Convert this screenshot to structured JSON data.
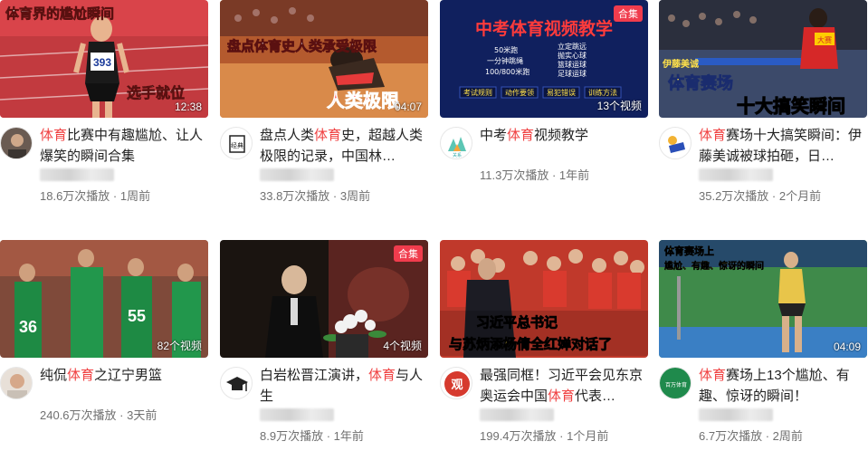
{
  "videos": [
    {
      "title_pre": "",
      "title_kw": "体育",
      "title_post": "比赛中有趣尴尬、让人爆笑的瞬间合集",
      "views": "18.6万次播放",
      "age": "1周前",
      "overlay_top": "体育界的尴尬瞬间",
      "overlay_bottom": "选手就位",
      "bib": "393",
      "duration": "12:38",
      "tag": ""
    },
    {
      "title_pre": "盘点人类",
      "title_kw": "体育",
      "title_post": "史，超越人类极限的记录，中国林…",
      "views": "33.8万次播放",
      "age": "3周前",
      "overlay_top": "盘点体育史人类承受极限",
      "overlay_bottom": "人类极限",
      "duration": "04:07",
      "tag": ""
    },
    {
      "title_pre": "中考",
      "title_kw": "体育",
      "title_post": "视频教学",
      "views": "11.3万次播放",
      "age": "1年前",
      "overlay_top": "中考体育视频教学",
      "lines_left": [
        "50米跑",
        "一分钟跳绳",
        "100/800米跑"
      ],
      "lines_right": [
        "立定跳远",
        "抛实心球",
        "篮球运球",
        "足球运球"
      ],
      "badges": [
        "考试规则",
        "动作要领",
        "易犯错误",
        "训练方法"
      ],
      "duration": "13个视频",
      "tag": "合集"
    },
    {
      "title_pre": "",
      "title_kw": "体育",
      "title_post": "赛场十大搞笑瞬间：伊藤美诚被球拍砸，日…",
      "views": "35.2万次播放",
      "age": "2个月前",
      "overlay_top": "伊藤美诚",
      "overlay_mid": "体育赛场",
      "overlay_bottom": "十大搞笑瞬间",
      "jersey": "大赛",
      "duration": "",
      "tag": ""
    },
    {
      "title_pre": "纯侃",
      "title_kw": "体育",
      "title_post": "之辽宁男篮",
      "views": "240.6万次播放",
      "age": "3天前",
      "jerseys": [
        "36",
        "55"
      ],
      "duration": "82个视频",
      "tag": ""
    },
    {
      "title_pre": "白岩松晋江演讲，",
      "title_kw": "体育",
      "title_post": "与人生",
      "views": "8.9万次播放",
      "age": "1年前",
      "duration": "4个视频",
      "tag": "合集"
    },
    {
      "title_pre": "最强同框！习近平会见东京奥运会中国",
      "title_kw": "体育",
      "title_post": "代表…",
      "views": "199.4万次播放",
      "age": "1个月前",
      "overlay_top": "习近平总书记",
      "overlay_bottom": "与苏炳添杨倩全红婵对话了",
      "duration": "",
      "tag": ""
    },
    {
      "title_pre": "",
      "title_kw": "体育",
      "title_post": "赛场上13个尴尬、有趣、惊讶的瞬间！",
      "views": "6.7万次播放",
      "age": "2周前",
      "overlay_top": "体育赛场上",
      "overlay_mid": "尴尬、有趣、惊讶的瞬间",
      "duration": "04:09",
      "tag": ""
    }
  ],
  "avatars": {
    "ch2": "经典",
    "ch3": "关系",
    "ch7": "观",
    "ch8": "百万体育"
  },
  "colors": {
    "keyword": "#f04142",
    "tag_bg": "#f03c4d",
    "meta": "#707070"
  }
}
